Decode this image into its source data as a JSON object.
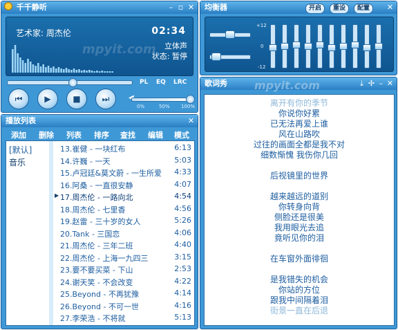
{
  "player": {
    "title": "千千静听",
    "artist": "艺术家: 周杰伦",
    "time": "02:34",
    "channel": "立体声",
    "state": "状态: 暂停",
    "watermark": "mpyit.com",
    "modes": [
      "PL",
      "EQ",
      "LRC"
    ],
    "volume_scale": [
      "0%",
      "50%",
      "100%"
    ],
    "seek_progress": 0.5,
    "volume": 0.9
  },
  "eq": {
    "title": "均衡器",
    "buttons": [
      "开启",
      "重设",
      "配置"
    ],
    "scale": [
      "+12",
      "0",
      "-12"
    ]
  },
  "playlist": {
    "title": "播放列表",
    "toolbar": [
      "添加",
      "删除",
      "列表",
      "排序",
      "查找",
      "编辑",
      "模式"
    ],
    "groups": [
      "[默认]",
      "音乐"
    ],
    "tracks": [
      {
        "title": "13.崔健 - 一块红布",
        "dur": "6:13"
      },
      {
        "title": "14.许巍 - 一天",
        "dur": "5:03"
      },
      {
        "title": "15.卢冠廷&莫文蔚 - 一生所爱",
        "dur": "4:33"
      },
      {
        "title": "16.阿桑 - 一直很安静",
        "dur": "4:07"
      },
      {
        "title": "17.周杰伦 - 一路向北",
        "dur": "4:54"
      },
      {
        "title": "18.周杰伦 - 七里香",
        "dur": "4:56"
      },
      {
        "title": "19.赵雷 - 三十岁的女人",
        "dur": "5:26"
      },
      {
        "title": "20.Tank - 三国恋",
        "dur": "4:06"
      },
      {
        "title": "21.周杰伦 - 三年二班",
        "dur": "4:40"
      },
      {
        "title": "22.周杰伦 - 上海一九四三",
        "dur": "3:15"
      },
      {
        "title": "23.要不要买菜 - 下山",
        "dur": "2:53"
      },
      {
        "title": "24.谢天笑 - 不会改变",
        "dur": "4:22"
      },
      {
        "title": "25.Beyond - 不再犹豫",
        "dur": "4:14"
      },
      {
        "title": "26.Beyond - 不可一世",
        "dur": "4:16"
      },
      {
        "title": "27.李荣浩 - 不将就",
        "dur": "5:13"
      }
    ]
  },
  "lyrics": {
    "title": "歌词秀",
    "watermark": "mpyit.com",
    "lines": [
      "离开有你的季节",
      "你说你好累",
      "已无法再爱上谁",
      "风在山路吹",
      "过往的画面全都是我不对",
      "细数惭愧 我伤你几回",
      "",
      "后视镜里的世界",
      "",
      "越来越远的道别",
      "你转身向背",
      "侧脸还是很美",
      "我用眼光去追",
      "竟听见你的泪",
      "",
      "在车窗外面徘徊",
      "",
      "是我错失的机会",
      "你站的方位",
      "跟我中间隔着泪",
      "街景一直在后退"
    ]
  }
}
